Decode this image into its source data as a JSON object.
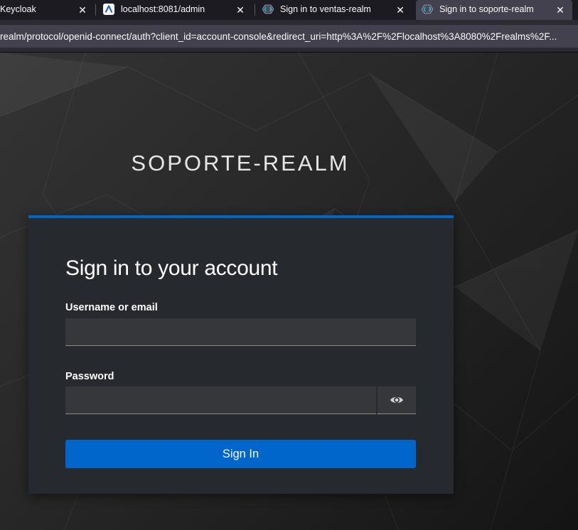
{
  "browser": {
    "tabs": [
      {
        "title": "Keycloak",
        "active": false
      },
      {
        "title": "localhost:8081/admin",
        "active": false,
        "icon": "app-logo-icon"
      },
      {
        "title": "Sign in to ventas-realm",
        "active": false,
        "icon": "keycloak-icon"
      },
      {
        "title": "Sign in to soporte-realm",
        "active": true,
        "icon": "keycloak-icon"
      }
    ],
    "close_glyph": "✕",
    "url": "realm/protocol/openid-connect/auth?client_id=account-console&redirect_uri=http%3A%2F%2Flocalhost%3A8080%2Frealms%2F..."
  },
  "page": {
    "realm_name": "SOPORTE-REALM",
    "heading": "Sign in to your account",
    "username_label": "Username or email",
    "username_value": "",
    "password_label": "Password",
    "password_value": "",
    "show_password_icon": "eye-icon",
    "submit_label": "Sign In"
  },
  "colors": {
    "accent": "#0066cc",
    "card_bg": "#26292d",
    "input_bg": "#36373a",
    "tab_bg": "#1c1b22",
    "active_tab_bg": "#42414d"
  }
}
